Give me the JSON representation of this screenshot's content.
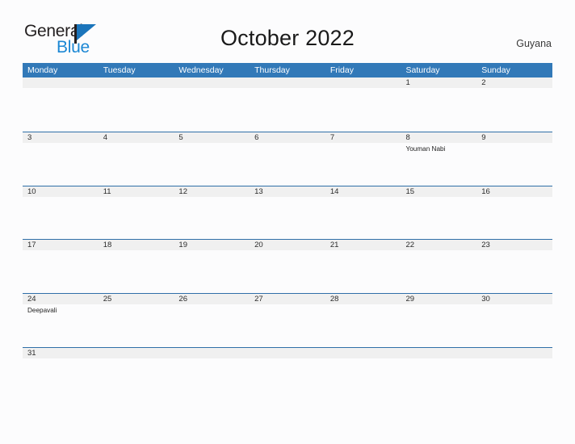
{
  "brand": {
    "name_part1": "General",
    "name_part2": "Blue",
    "flag_icon": "flag-triangle-icon"
  },
  "header": {
    "title": "October 2022",
    "country": "Guyana"
  },
  "colors": {
    "header_blue": "#3279b8",
    "row_separator_blue": "#2f6fa8",
    "date_band_gray": "#f0f0f0",
    "brand_blue": "#1b87d4",
    "page_background": "#fcfcfd"
  },
  "calendar": {
    "month": "October",
    "year": "2022",
    "weekday_headers": [
      "Monday",
      "Tuesday",
      "Wednesday",
      "Thursday",
      "Friday",
      "Saturday",
      "Sunday"
    ],
    "weeks": [
      {
        "days": [
          {
            "date": "",
            "events": []
          },
          {
            "date": "",
            "events": []
          },
          {
            "date": "",
            "events": []
          },
          {
            "date": "",
            "events": []
          },
          {
            "date": "",
            "events": []
          },
          {
            "date": "1",
            "events": []
          },
          {
            "date": "2",
            "events": []
          }
        ]
      },
      {
        "days": [
          {
            "date": "3",
            "events": []
          },
          {
            "date": "4",
            "events": []
          },
          {
            "date": "5",
            "events": []
          },
          {
            "date": "6",
            "events": []
          },
          {
            "date": "7",
            "events": []
          },
          {
            "date": "8",
            "events": [
              "Youman Nabi"
            ]
          },
          {
            "date": "9",
            "events": []
          }
        ]
      },
      {
        "days": [
          {
            "date": "10",
            "events": []
          },
          {
            "date": "11",
            "events": []
          },
          {
            "date": "12",
            "events": []
          },
          {
            "date": "13",
            "events": []
          },
          {
            "date": "14",
            "events": []
          },
          {
            "date": "15",
            "events": []
          },
          {
            "date": "16",
            "events": []
          }
        ]
      },
      {
        "days": [
          {
            "date": "17",
            "events": []
          },
          {
            "date": "18",
            "events": []
          },
          {
            "date": "19",
            "events": []
          },
          {
            "date": "20",
            "events": []
          },
          {
            "date": "21",
            "events": []
          },
          {
            "date": "22",
            "events": []
          },
          {
            "date": "23",
            "events": []
          }
        ]
      },
      {
        "days": [
          {
            "date": "24",
            "events": [
              "Deepavali"
            ]
          },
          {
            "date": "25",
            "events": []
          },
          {
            "date": "26",
            "events": []
          },
          {
            "date": "27",
            "events": []
          },
          {
            "date": "28",
            "events": []
          },
          {
            "date": "29",
            "events": []
          },
          {
            "date": "30",
            "events": []
          }
        ]
      },
      {
        "days": [
          {
            "date": "31",
            "events": []
          },
          {
            "date": "",
            "events": []
          },
          {
            "date": "",
            "events": []
          },
          {
            "date": "",
            "events": []
          },
          {
            "date": "",
            "events": []
          },
          {
            "date": "",
            "events": []
          },
          {
            "date": "",
            "events": []
          }
        ]
      }
    ]
  }
}
